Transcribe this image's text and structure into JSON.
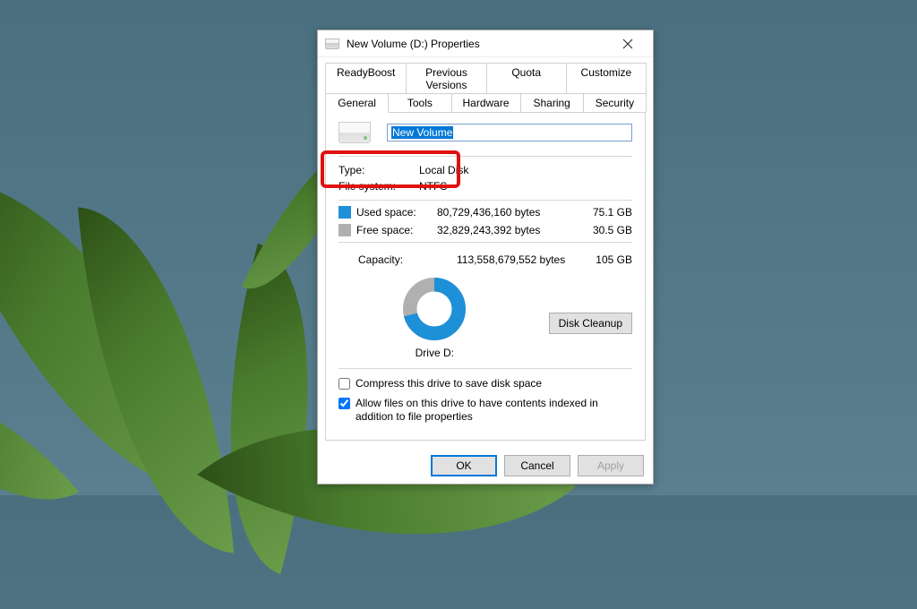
{
  "window": {
    "title": "New Volume (D:) Properties"
  },
  "tabs": {
    "back": [
      "ReadyBoost",
      "Previous Versions",
      "Quota",
      "Customize"
    ],
    "front": [
      "General",
      "Tools",
      "Hardware",
      "Sharing",
      "Security"
    ],
    "active": "General"
  },
  "volume": {
    "name": "New Volume",
    "type_label": "Type:",
    "type_value": "Local Disk",
    "fs_label": "File system:",
    "fs_value": "NTFS"
  },
  "space": {
    "used_label": "Used space:",
    "used_bytes": "80,729,436,160 bytes",
    "used_human": "75.1 GB",
    "free_label": "Free space:",
    "free_bytes": "32,829,243,392 bytes",
    "free_human": "30.5 GB",
    "capacity_label": "Capacity:",
    "capacity_bytes": "113,558,679,552 bytes",
    "capacity_human": "105 GB"
  },
  "drive_label": "Drive D:",
  "cleanup_label": "Disk Cleanup",
  "options": {
    "compress": "Compress this drive to save disk space",
    "index": "Allow files on this drive to have contents indexed in addition to file properties"
  },
  "buttons": {
    "ok": "OK",
    "cancel": "Cancel",
    "apply": "Apply"
  },
  "chart_data": {
    "type": "pie",
    "title": "Drive D:",
    "series": [
      {
        "name": "Used space",
        "value": 80729436160,
        "color": "#1e90d8"
      },
      {
        "name": "Free space",
        "value": 32829243392,
        "color": "#b0b0b0"
      }
    ]
  }
}
